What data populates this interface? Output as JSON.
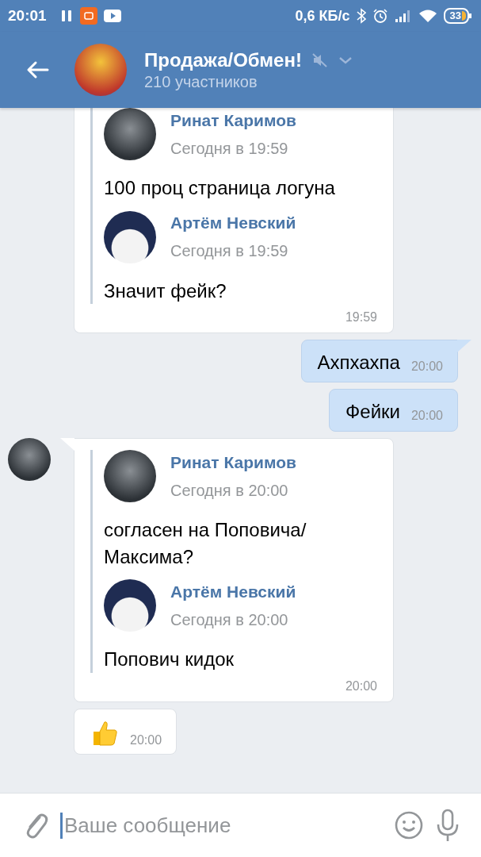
{
  "status_bar": {
    "time": "20:01",
    "speed": "0,6 КБ/с",
    "battery": "33"
  },
  "header": {
    "title": "Продажа/Обмен!",
    "subtitle": "210 участников",
    "muted": true
  },
  "messages": [
    {
      "kind": "incoming",
      "forwards": [
        {
          "name": "Ринат Каримов",
          "date": "Сегодня в 19:59",
          "text": "100 проц страница логуна"
        },
        {
          "name": "Артём Невский",
          "date": "Сегодня в 19:59",
          "text": "Значит фейк?"
        }
      ],
      "time": "19:59"
    },
    {
      "kind": "outgoing",
      "tail": true,
      "text": "Ахпхахпа",
      "time": "20:00"
    },
    {
      "kind": "outgoing",
      "tail": false,
      "text": "Фейки",
      "time": "20:00"
    },
    {
      "kind": "incoming",
      "tail": true,
      "show_avatar": true,
      "forwards": [
        {
          "name": "Ринат Каримов",
          "date": "Сегодня в 20:00",
          "text": "согласен на Поповича/ Максима?"
        },
        {
          "name": "Артём Невский",
          "date": "Сегодня в 20:00",
          "text": "Попович кидок"
        }
      ],
      "time": "20:00"
    },
    {
      "kind": "sticker",
      "time": "20:00"
    }
  ],
  "composer": {
    "placeholder": "Ваше сообщение"
  }
}
